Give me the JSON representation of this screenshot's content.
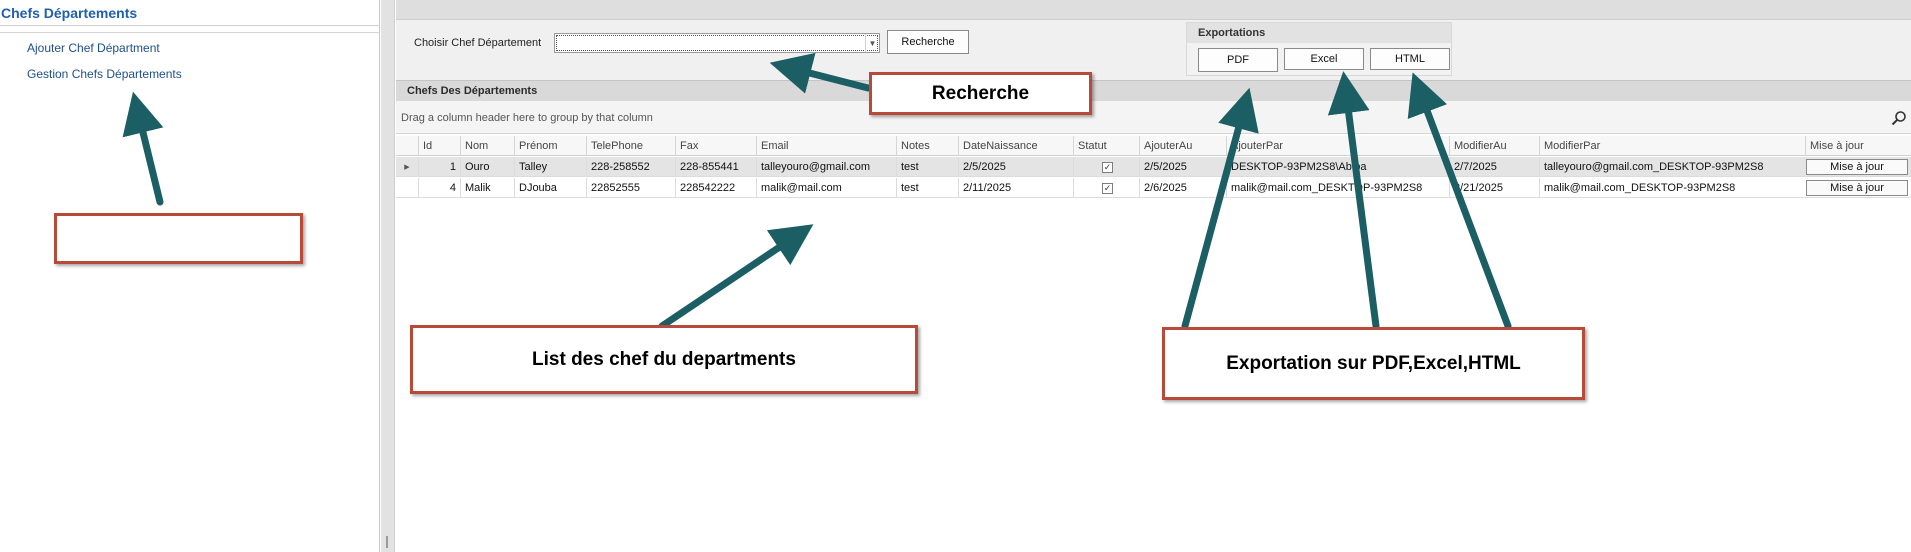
{
  "nav": {
    "title": "Chefs Départements",
    "items": [
      {
        "label": "Ajouter Chef Départment"
      },
      {
        "label": "Gestion Chefs Départements"
      }
    ]
  },
  "filter": {
    "label": "Choisir Chef Département",
    "value": "",
    "search_button": "Recherche"
  },
  "exports": {
    "title": "Exportations",
    "pdf": "PDF",
    "excel": "Excel",
    "html": "HTML"
  },
  "grid": {
    "caption": "Chefs Des Départements",
    "group_hint": "Drag a column header here to group by that column",
    "columns": [
      "Id",
      "Nom",
      "Prénom",
      "TelePhone",
      "Fax",
      "Email",
      "Notes",
      "DateNaissance",
      "Statut",
      "AjouterAu",
      "AjouterPar",
      "ModifierAu",
      "ModifierPar",
      "Mise à jour"
    ],
    "rows": [
      {
        "id": "1",
        "nom": "Ouro",
        "prenom": "Talley",
        "telephone": "228-258552",
        "fax": "228-855441",
        "email": "talleyouro@gmail.com",
        "notes": "test",
        "date_naissance": "2/5/2025",
        "statut": true,
        "ajouter_au": "2/5/2025",
        "ajouter_par": "DESKTOP-93PM2S8\\Abiba",
        "modifier_au": "2/7/2025",
        "modifier_par": "talleyouro@gmail.com_DESKTOP-93PM2S8",
        "action": "Mise à jour"
      },
      {
        "id": "4",
        "nom": "Malik",
        "prenom": "DJouba",
        "telephone": "22852555",
        "fax": "228542222",
        "email": "malik@mail.com",
        "notes": "test",
        "date_naissance": "2/11/2025",
        "statut": true,
        "ajouter_au": "2/6/2025",
        "ajouter_par": "malik@mail.com_DESKTOP-93PM2S8",
        "modifier_au": "2/21/2025",
        "modifier_par": "malik@mail.com_DESKTOP-93PM2S8",
        "action": "Mise à jour"
      }
    ]
  },
  "annotations": {
    "recherche": "Recherche",
    "list": "List des chef du departments",
    "export": "Exportation sur PDF,Excel,HTML",
    "empty": ""
  },
  "colors": {
    "nav_title": "#1f5fae",
    "callout_border": "#b84a3a",
    "arrow": "#1b5e63"
  },
  "icons": {
    "grid_search": "search-icon",
    "checkbox": "check-icon",
    "combo": "chevron-down-icon",
    "row_indicator": "row-indicator-icon"
  }
}
